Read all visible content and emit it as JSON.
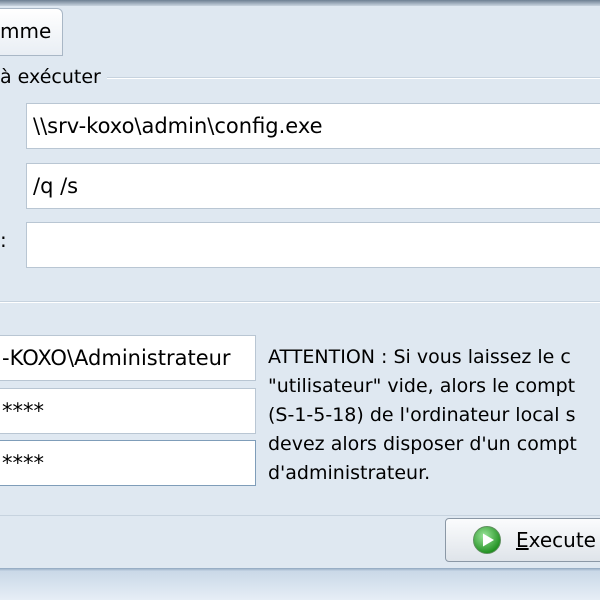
{
  "tab": {
    "label": "mme"
  },
  "program_group": {
    "legend": "à exécuter",
    "program_path": "\\\\srv-koxo\\admin\\config.exe",
    "arguments": "/q /s",
    "field3_label": ":",
    "field3_value": ""
  },
  "credentials": {
    "username": "-KOXO\\Administrateur",
    "password": "****",
    "password_confirm": "****"
  },
  "warning": {
    "lines": [
      "ATTENTION : Si vous laissez le c",
      "\"utilisateur\" vide, alors le compt",
      "(S-1-5-18) de l'ordinateur local s",
      "devez alors disposer d'un compt",
      "d'administrateur."
    ]
  },
  "execute_button": {
    "label_first": "E",
    "label_rest": "xecute"
  },
  "colors": {
    "background": "#dfe8f1",
    "field_border": "#b9c6d3",
    "play_green": "#2fae2f"
  }
}
